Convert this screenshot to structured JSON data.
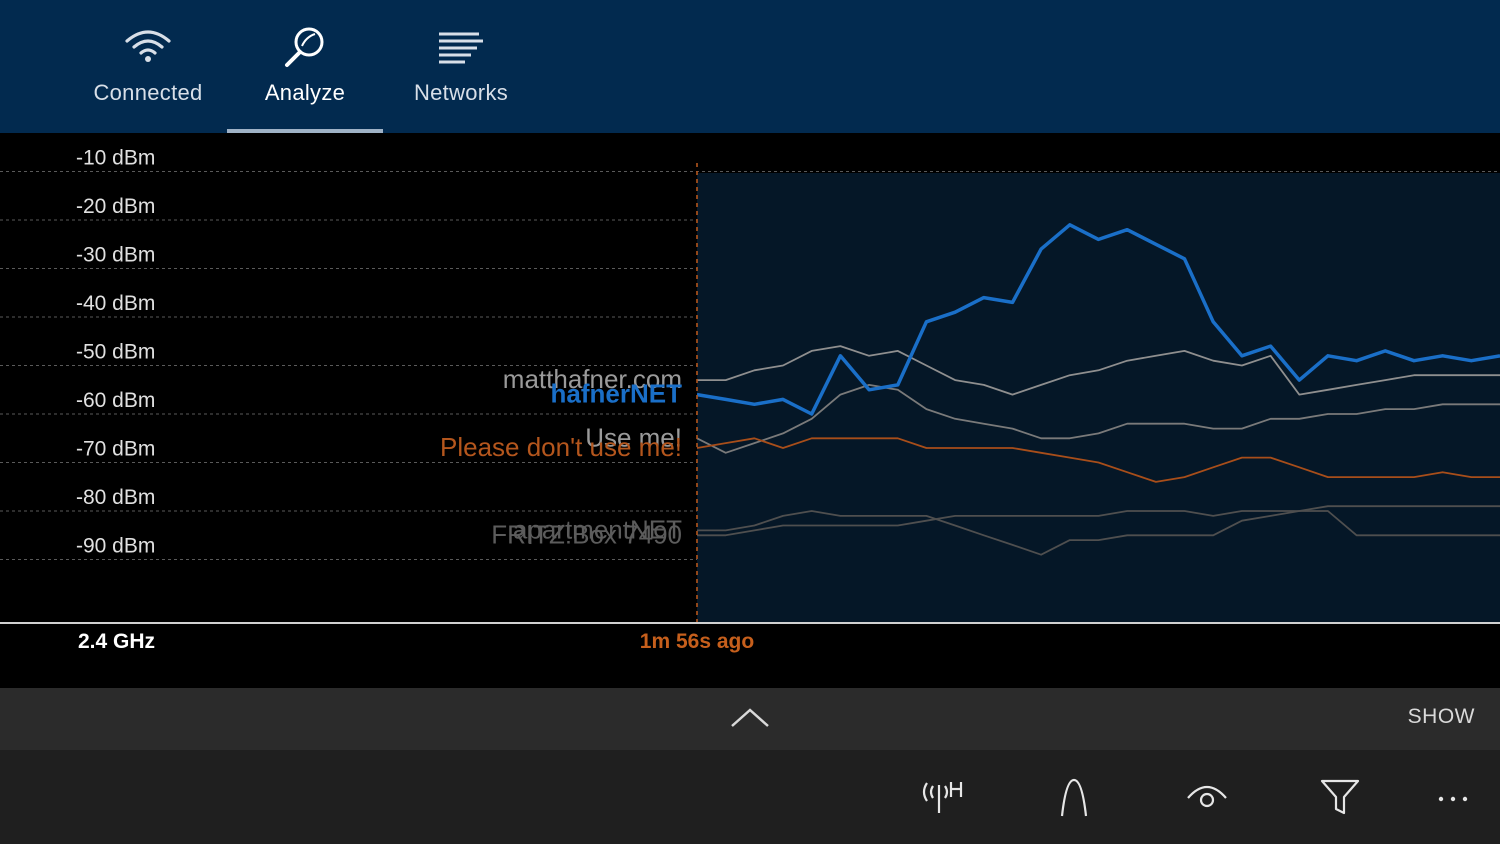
{
  "nav": {
    "tabs": [
      {
        "label": "Connected",
        "icon": "wifi-icon",
        "active": false
      },
      {
        "label": "Analyze",
        "icon": "magnifier-icon",
        "active": true
      },
      {
        "label": "Networks",
        "icon": "list-icon",
        "active": false
      }
    ]
  },
  "chart": {
    "band_label": "2.4 GHz",
    "time_marker_label": "1m 56s ago"
  },
  "chart_data": {
    "type": "line",
    "y_unit": "dBm",
    "y_ticks": [
      "-10 dBm",
      "-20 dBm",
      "-30 dBm",
      "-40 dBm",
      "-50 dBm",
      "-60 dBm",
      "-70 dBm",
      "-80 dBm",
      "-90 dBm"
    ],
    "ylim": [
      -100,
      0
    ],
    "grid": true,
    "series": [
      {
        "name": "matthafner.com",
        "color": "#8f8f8f",
        "highlight": false,
        "values": [
          -53,
          -53,
          -51,
          -50,
          -47,
          -46,
          -48,
          -47,
          -50,
          -53,
          -54,
          -56,
          -54,
          -52,
          -51,
          -49,
          -48,
          -47,
          -49,
          -50,
          -48,
          -56,
          -55,
          -54,
          -53,
          -52,
          -52,
          -52,
          -52
        ]
      },
      {
        "name": "hafnerNET",
        "color": "#1a6fc8",
        "highlight": true,
        "values": [
          -56,
          -57,
          -58,
          -57,
          -60,
          -48,
          -55,
          -54,
          -41,
          -39,
          -36,
          -37,
          -26,
          -21,
          -24,
          -22,
          -25,
          -28,
          -41,
          -48,
          -46,
          -53,
          -48,
          -49,
          -47,
          -49,
          -48,
          -49,
          -48
        ]
      },
      {
        "name": "Use me!",
        "color": "#7a7a7a",
        "highlight": false,
        "values": [
          -65,
          -68,
          -66,
          -64,
          -61,
          -56,
          -54,
          -55,
          -59,
          -61,
          -62,
          -63,
          -65,
          -65,
          -64,
          -62,
          -62,
          -62,
          -63,
          -63,
          -61,
          -61,
          -60,
          -60,
          -59,
          -59,
          -58,
          -58,
          -58
        ]
      },
      {
        "name": "Please don't use me!",
        "color": "#a84e1a",
        "highlight": false,
        "values": [
          -67,
          -66,
          -65,
          -67,
          -65,
          -65,
          -65,
          -65,
          -67,
          -67,
          -67,
          -67,
          -68,
          -69,
          -70,
          -72,
          -74,
          -73,
          -71,
          -69,
          -69,
          -71,
          -73,
          -73,
          -73,
          -73,
          -72,
          -73,
          -73
        ]
      },
      {
        "name": "FRITZ!Box 7490",
        "color": "#4f4f4f",
        "highlight": false,
        "values": [
          -85,
          -85,
          -84,
          -83,
          -83,
          -83,
          -83,
          -83,
          -82,
          -81,
          -81,
          -81,
          -81,
          -81,
          -81,
          -80,
          -80,
          -80,
          -81,
          -80,
          -80,
          -80,
          -80,
          -85,
          -85,
          -85,
          -85,
          -85,
          -85
        ]
      },
      {
        "name": "apartmentNET",
        "color": "#4f4f4f",
        "highlight": false,
        "values": [
          -84,
          -84,
          -83,
          -81,
          -80,
          -81,
          -81,
          -81,
          -81,
          -83,
          -85,
          -87,
          -89,
          -86,
          -86,
          -85,
          -85,
          -85,
          -85,
          -82,
          -81,
          -80,
          -79,
          -79,
          -79,
          -79,
          -79,
          -79,
          -79
        ]
      }
    ]
  },
  "expand_bar": {
    "show_label": "SHOW"
  },
  "command_bar": {
    "buttons": [
      "signal-h-icon",
      "curve-icon",
      "eye-icon",
      "filter-icon",
      "more-icon"
    ]
  }
}
